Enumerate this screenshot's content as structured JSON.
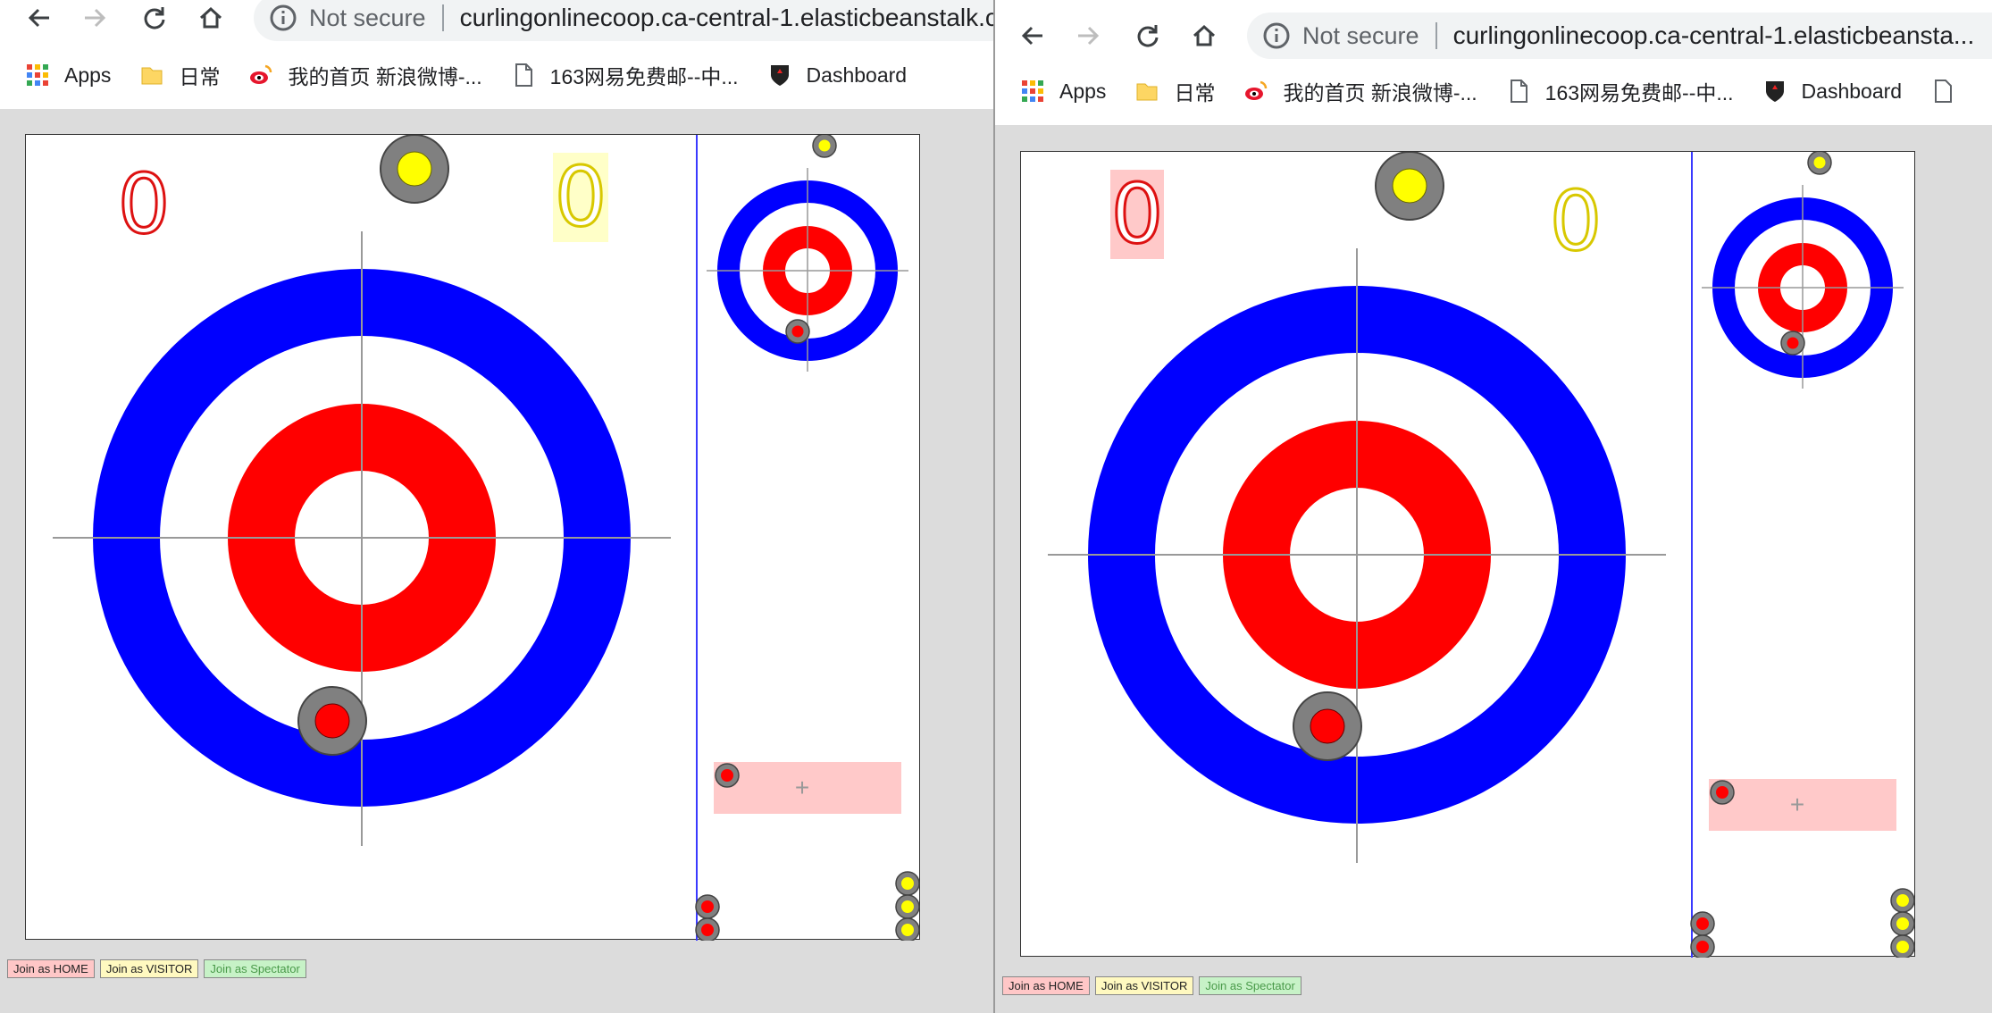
{
  "browser": {
    "not_secure_label": "Not secure",
    "url_left": "curlingonlinecoop.ca-central-1.elasticbeanstalk.c",
    "url_right": "curlingonlinecoop.ca-central-1.elasticbeansta...",
    "bookmarks": [
      "Apps",
      "日常",
      "我的首页 新浪微博-...",
      "163网易免费邮--中...",
      "Dashboard"
    ]
  },
  "game": {
    "home_score": "0",
    "visitor_score": "0",
    "join_home": "Join as HOME",
    "join_visitor": "Join as VISITOR",
    "join_spectator": "Join as Spectator",
    "add_symbol": "+"
  },
  "colors": {
    "ring_outer": "#0000ff",
    "ring_inner": "#ff0000",
    "home_stone": "#ff0000",
    "visitor_stone": "#ffff00",
    "stone_body": "#808080",
    "home_highlight": "#ffc9c9",
    "visitor_highlight": "#ffffc8"
  }
}
